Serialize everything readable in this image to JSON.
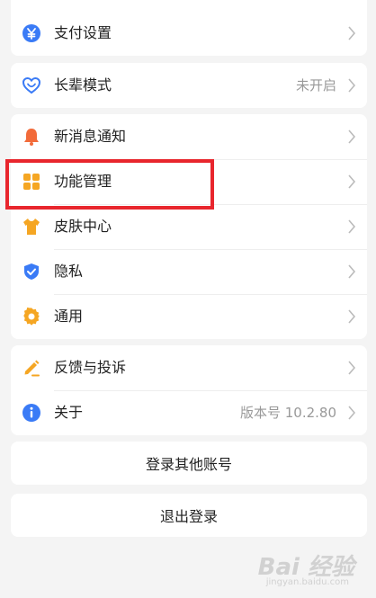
{
  "groups": {
    "payment": {
      "items": [
        {
          "label": "支付设置",
          "icon": "yuan-coin-icon",
          "color": "#3a7bf6"
        }
      ]
    },
    "elder": {
      "items": [
        {
          "label": "长辈模式",
          "value": "未开启",
          "icon": "heart-outline-icon",
          "color": "#3a7bf6"
        }
      ]
    },
    "settings": {
      "items": [
        {
          "label": "新消息通知",
          "icon": "bell-icon",
          "color": "#f26b3a"
        },
        {
          "label": "功能管理",
          "icon": "grid-squares-icon",
          "color": "#f5a623"
        },
        {
          "label": "皮肤中心",
          "icon": "tshirt-icon",
          "color": "#f5a623"
        },
        {
          "label": "隐私",
          "icon": "shield-check-icon",
          "color": "#3a7bf6"
        },
        {
          "label": "通用",
          "icon": "gear-icon",
          "color": "#f5a623"
        }
      ]
    },
    "about": {
      "items": [
        {
          "label": "反馈与投诉",
          "icon": "pencil-icon",
          "color": "#f5a623"
        },
        {
          "label": "关于",
          "value": "版本号 10.2.80",
          "icon": "info-icon",
          "color": "#3a7bf6"
        }
      ]
    }
  },
  "buttons": {
    "switch_account": "登录其他账号",
    "logout": "退出登录"
  },
  "watermark": {
    "text": "Bai 经验",
    "sub": "jingyan.baidu.com"
  },
  "colors": {
    "highlight": "#e8262d",
    "background": "#f4f4f4"
  }
}
